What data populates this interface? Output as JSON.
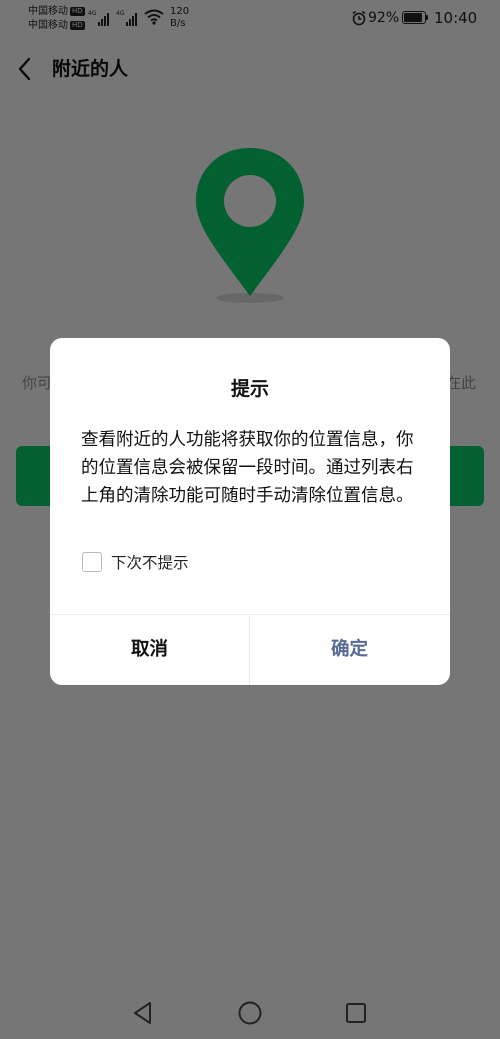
{
  "status_bar": {
    "carrier_1": "中国移动",
    "carrier_2": "中国移动",
    "hd_badge": "HD",
    "network_type": "4G",
    "net_speed_value": "120",
    "net_speed_unit": "B/s",
    "battery_percent": "92%",
    "battery_level": 0.92,
    "time": "10:40"
  },
  "nav": {
    "title": "附近的人",
    "back_icon": "chevron-left-icon"
  },
  "content": {
    "pin_icon": "location-pin-icon",
    "pin_color": "#07c160",
    "side_text_left": "你可",
    "side_text_right": "在此",
    "primary_button_color": "#07c160"
  },
  "dialog": {
    "title": "提示",
    "message": "查看附近的人功能将获取你的位置信息，你的位置信息会被保留一段时间。通过列表右上角的清除功能可随时手动清除位置信息。",
    "checkbox_label": "下次不提示",
    "checkbox_checked": false,
    "cancel_label": "取消",
    "confirm_label": "确定",
    "confirm_color": "#576b95"
  },
  "system_nav": {
    "back": "triangle-back-icon",
    "home": "circle-home-icon",
    "recents": "square-recents-icon"
  }
}
